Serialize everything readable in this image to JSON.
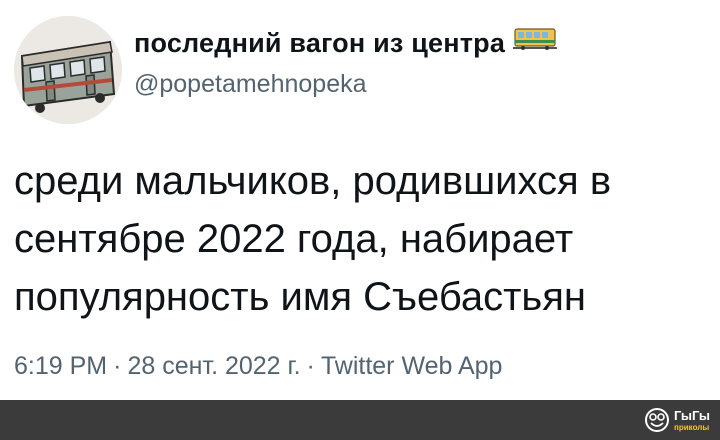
{
  "author": {
    "display_name": "последний вагон из центра",
    "name_emoji": "tram-car-icon",
    "handle": "@popetamehnopeka"
  },
  "tweet": {
    "lines": [
      "среди мальчиков, родившихся в",
      "сентябре 2022 года, набирает",
      "популярность имя Съебастьян"
    ],
    "time": "6:19 PM",
    "date": "28 сент. 2022 г.",
    "source": "Twitter Web App",
    "separator": "·"
  },
  "watermark": {
    "title": "ГыГы",
    "subtitle": "приколы",
    "icon": "face-logo-icon"
  },
  "colors": {
    "text": "#0f1419",
    "secondary": "#536471",
    "bar": "#3b3b3b",
    "watermark_accent": "#f4c430"
  }
}
